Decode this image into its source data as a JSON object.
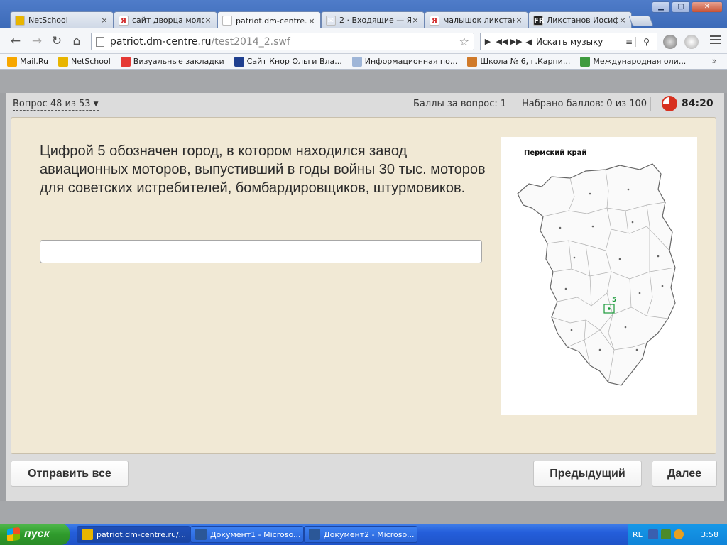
{
  "browser": {
    "tabs": [
      {
        "label": "NetSchool",
        "favicon": "netschool-icon",
        "color": "#e8b500",
        "glyph": "",
        "active": false
      },
      {
        "label": "сайт дворца моло",
        "favicon": "yandex-icon",
        "color": "#ffffff",
        "glyph": "Я",
        "active": false
      },
      {
        "label": "patriot.dm-centre.r",
        "favicon": "page-icon",
        "color": "#ffffff",
        "glyph": "",
        "active": true
      },
      {
        "label": "2 · Входящие — Я",
        "favicon": "mail-icon",
        "color": "#e0e6f0",
        "glyph": "✉",
        "active": false
      },
      {
        "label": "малышок ликстан",
        "favicon": "yandex-icon",
        "color": "#ffffff",
        "glyph": "Я",
        "active": false
      },
      {
        "label": "Ликстанов Иосиф",
        "favicon": "fr-icon",
        "color": "#222222",
        "glyph": "FR",
        "active": false
      }
    ],
    "tab_close_glyph": "×",
    "window_buttons": {
      "minimize": "▁",
      "maximize": "▢",
      "close": "✕"
    },
    "address": {
      "host": "patriot.dm-centre.ru",
      "path": "/test2014_2.swf"
    },
    "music_bar": {
      "label": "Искать музыку"
    },
    "bookmarks": [
      {
        "label": "Mail.Ru",
        "icon": "mailru-icon",
        "color": "#f7a700"
      },
      {
        "label": "NetSchool",
        "icon": "netschool-icon",
        "color": "#e8b500"
      },
      {
        "label": "Визуальные закладки",
        "icon": "yandex-icon",
        "color": "#e53935"
      },
      {
        "label": "Сайт Кнор Ольги Вла...",
        "icon": "uk-flag-icon",
        "color": "#1f3f8f"
      },
      {
        "label": "Информационная по...",
        "icon": "page-icon",
        "color": "#9fb6d8"
      },
      {
        "label": "Школа № 6, г.Карпи...",
        "icon": "school-icon",
        "color": "#d07a2a"
      },
      {
        "label": "Международная оли...",
        "icon": "leaf-icon",
        "color": "#3f9b3f"
      }
    ],
    "bookmarks_more": "»"
  },
  "quiz": {
    "question_counter": "Вопрос 48 из 53",
    "points_per_question": "Баллы за вопрос: 1",
    "points_total": "Набрано баллов: 0 из 100",
    "timer": "84:20",
    "question_text": "Цифрой 5 обозначен город, в котором находился завод авиационных моторов, выпустивший в годы войны 30 тыс. моторов для советских истребителей, бомбардировщиков, штурмовиков.",
    "answer_value": "",
    "map": {
      "title": "Пермский край",
      "marker_label": "5",
      "marker_color": "#1a9a3a"
    },
    "buttons": {
      "submit_all": "Отправить все",
      "previous": "Предыдущий",
      "next": "Далее"
    }
  },
  "taskbar": {
    "start_label": "пуск",
    "tasks": [
      {
        "label": "patriot.dm-centre.ru/...",
        "icon": "chrome-icon",
        "color": "#e8b500",
        "active": true
      },
      {
        "label": "Документ1 - Microso...",
        "icon": "word-icon",
        "color": "#2b5797",
        "active": false
      },
      {
        "label": "Документ2 - Microso...",
        "icon": "word-icon",
        "color": "#2b5797",
        "active": false
      }
    ],
    "tray": {
      "language": "RL",
      "clock": "3:58"
    }
  }
}
